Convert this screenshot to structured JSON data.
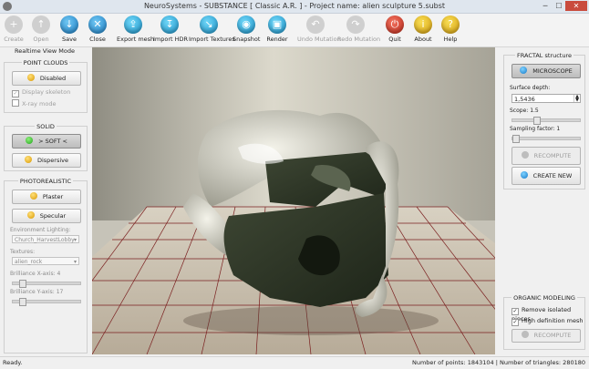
{
  "window": {
    "title": "NeuroSystems - SUBSTANCE  [ Classic A.R. ]   -   Project name: alien sculpture 5.subst",
    "minimize": "─",
    "maximize": "☐",
    "close": "✕"
  },
  "toolbar": [
    {
      "label": "Create",
      "icon": "plus-icon",
      "glyph": "+",
      "enabled": false,
      "color": "#cfcfcf"
    },
    {
      "label": "Open",
      "icon": "folder-open-icon",
      "glyph": "↑",
      "enabled": false,
      "color": "#cfcfcf"
    },
    {
      "label": "Save",
      "icon": "save-icon",
      "glyph": "↓",
      "enabled": true,
      "color": "#1c7fc6"
    },
    {
      "label": "Close",
      "icon": "close-icon",
      "glyph": "✕",
      "enabled": true,
      "color": "#1c7fc6"
    },
    {
      "label": "Export mesh",
      "icon": "export-icon",
      "glyph": "⇪",
      "enabled": true,
      "color": "#1d93c9"
    },
    {
      "label": "Import HDR",
      "icon": "import-hdr-icon",
      "glyph": "↧",
      "enabled": true,
      "color": "#1d93c9"
    },
    {
      "label": "Import Textures",
      "icon": "import-textures-icon",
      "glyph": "↘",
      "enabled": true,
      "color": "#1d93c9"
    },
    {
      "label": "Snapshot",
      "icon": "camera-icon",
      "glyph": "◉",
      "enabled": true,
      "color": "#1d93c9"
    },
    {
      "label": "Render",
      "icon": "render-icon",
      "glyph": "▣",
      "enabled": true,
      "color": "#1d93c9"
    },
    {
      "label": "Undo Mutation",
      "icon": "undo-icon",
      "glyph": "↶",
      "enabled": false,
      "color": "#cfcfcf"
    },
    {
      "label": "Redo Mutation",
      "icon": "redo-icon",
      "glyph": "↷",
      "enabled": false,
      "color": "#cfcfcf"
    },
    {
      "label": "Quit",
      "icon": "power-icon",
      "glyph": "⏻",
      "enabled": true,
      "color": "#c22c1c"
    },
    {
      "label": "About",
      "icon": "info-icon",
      "glyph": "i",
      "enabled": true,
      "color": "#d79f0d"
    },
    {
      "label": "Help",
      "icon": "help-icon",
      "glyph": "?",
      "enabled": true,
      "color": "#d79f0d"
    }
  ],
  "left": {
    "header": "Realtime View Mode",
    "point_clouds": {
      "title": "POINT CLOUDS",
      "button": "Disabled",
      "display_skeleton": "Display skeleton",
      "xray": "X-ray mode"
    },
    "solid": {
      "title": "SOLID",
      "soft": "> SOFT <",
      "dispersive": "Dispersive"
    },
    "photorealistic": {
      "title": "PHOTOREALISTIC",
      "plaster": "Plaster",
      "specular": "Specular",
      "env_label": "Environment Lighting:",
      "env_value": "Church_HarvestLobby",
      "tex_label": "Textures:",
      "tex_value": "alien_rock",
      "bx_label": "Brilliance X-axis: 4",
      "bx_value": 0.1,
      "by_label": "Brilliance Y-axis: 17",
      "by_value": 0.1
    }
  },
  "right": {
    "fractal": {
      "title": "FRACTAL structure",
      "microscope": "MICROSCOPE",
      "depth_label": "Surface depth:",
      "depth_value": "1,5436",
      "scope_label": "Scope: 1.5",
      "scope_value": 0.35,
      "sampling_label": "Sampling factor: 1",
      "sampling_value": 0.0,
      "recompute": "RECOMPUTE",
      "create_new": "CREATE NEW"
    },
    "organic": {
      "title": "ORGANIC MODELING",
      "remove_isolated": "Remove isolated pieces",
      "high_def": "High definition mesh",
      "recompute": "RECOMPUTE"
    }
  },
  "status": {
    "left": "Ready.",
    "right": "Number of points: 1843104   |   Number of triangles: 280180"
  },
  "colors": {
    "floor_grid": "#7a1f1f",
    "mesh_dark": "#2a3322",
    "mesh_light": "#e8e8dc",
    "accent_blue": "#1c7fc6"
  }
}
